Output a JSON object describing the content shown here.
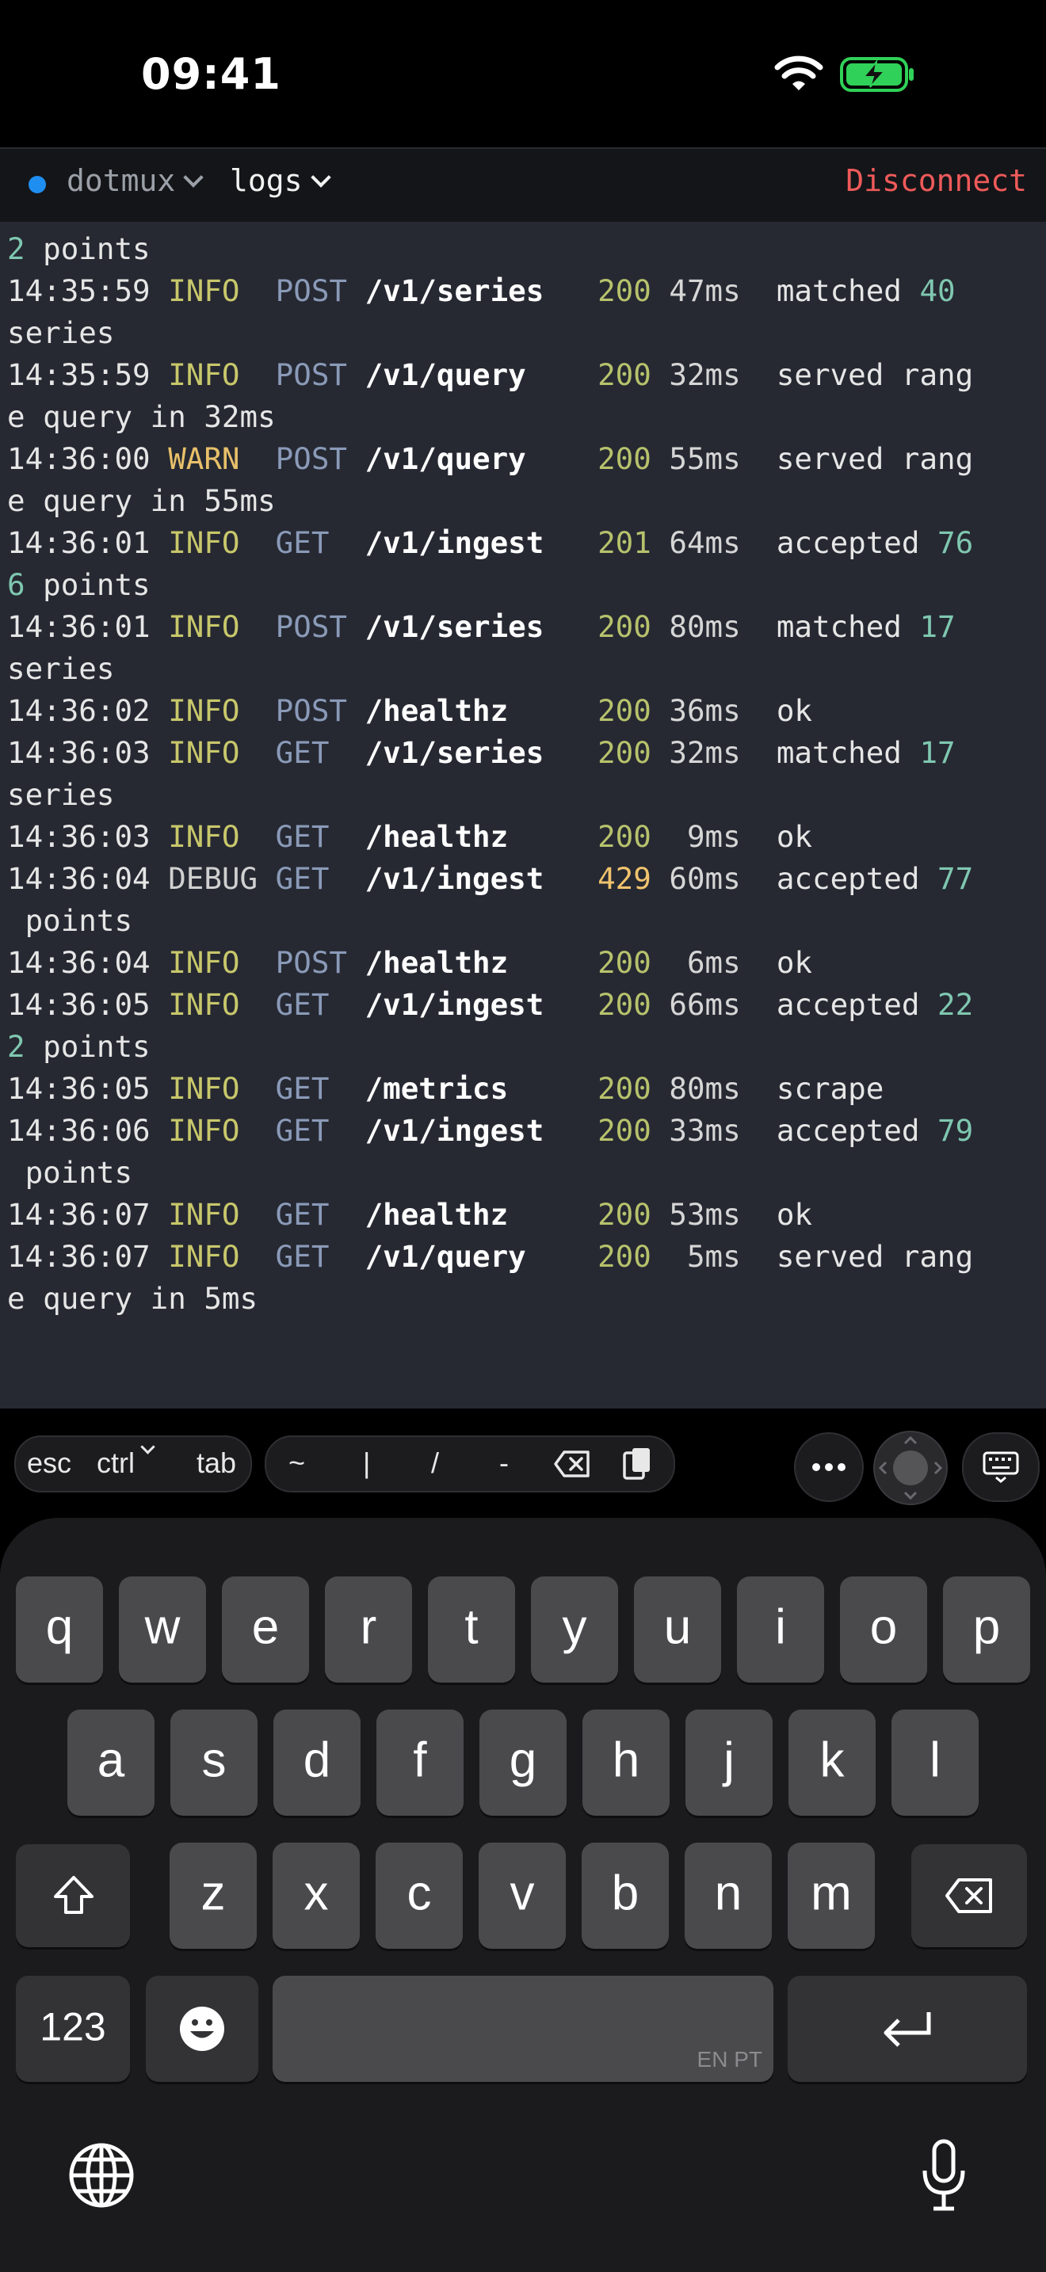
{
  "status_bar": {
    "time": "09:41",
    "wifi_icon": "wifi-icon",
    "battery_icon": "battery-charging-icon",
    "battery_color": "#30d158"
  },
  "tab_bar": {
    "connection_dot_color": "#1f8ef1",
    "session": "dotmux",
    "window": "logs",
    "disconnect": "Disconnect"
  },
  "terminal": {
    "top_fragment": {
      "num": "2",
      "text": " points"
    },
    "lines": [
      {
        "time": "14:35:59",
        "level": "INFO",
        "method": "POST",
        "path": "/v1/series",
        "status": "200",
        "duration": "47ms",
        "msg": "matched",
        "num": "40",
        "wrap": "series"
      },
      {
        "time": "14:35:59",
        "level": "INFO",
        "method": "POST",
        "path": "/v1/query",
        "status": "200",
        "duration": "32ms",
        "msg": "served rang",
        "wrap": "e query in 32ms"
      },
      {
        "time": "14:36:00",
        "level": "WARN",
        "method": "POST",
        "path": "/v1/query",
        "status": "200",
        "duration": "55ms",
        "msg": "served rang",
        "wrap": "e query in 55ms"
      },
      {
        "time": "14:36:01",
        "level": "INFO",
        "method": "GET",
        "path": "/v1/ingest",
        "status": "201",
        "duration": "64ms",
        "msg": "accepted",
        "num": "76",
        "wrap_num": "6",
        "wrap": " points"
      },
      {
        "time": "14:36:01",
        "level": "INFO",
        "method": "POST",
        "path": "/v1/series",
        "status": "200",
        "duration": "80ms",
        "msg": "matched",
        "num": "17",
        "wrap": "series"
      },
      {
        "time": "14:36:02",
        "level": "INFO",
        "method": "POST",
        "path": "/healthz",
        "status": "200",
        "duration": "36ms",
        "msg": "ok"
      },
      {
        "time": "14:36:03",
        "level": "INFO",
        "method": "GET",
        "path": "/v1/series",
        "status": "200",
        "duration": "32ms",
        "msg": "matched",
        "num": "17",
        "wrap": "series"
      },
      {
        "time": "14:36:03",
        "level": "INFO",
        "method": "GET",
        "path": "/healthz",
        "status": "200",
        "duration": "9ms",
        "msg": "ok"
      },
      {
        "time": "14:36:04",
        "level": "DEBUG",
        "method": "GET",
        "path": "/v1/ingest",
        "status": "429",
        "duration": "60ms",
        "msg": "accepted",
        "num": "77",
        "wrap": " points"
      },
      {
        "time": "14:36:04",
        "level": "INFO",
        "method": "POST",
        "path": "/healthz",
        "status": "200",
        "duration": "6ms",
        "msg": "ok"
      },
      {
        "time": "14:36:05",
        "level": "INFO",
        "method": "GET",
        "path": "/v1/ingest",
        "status": "200",
        "duration": "66ms",
        "msg": "accepted",
        "num": "22",
        "wrap_num": "2",
        "wrap": " points"
      },
      {
        "time": "14:36:05",
        "level": "INFO",
        "method": "GET",
        "path": "/metrics",
        "status": "200",
        "duration": "80ms",
        "msg": "scrape"
      },
      {
        "time": "14:36:06",
        "level": "INFO",
        "method": "GET",
        "path": "/v1/ingest",
        "status": "200",
        "duration": "33ms",
        "msg": "accepted",
        "num": "79",
        "wrap": " points"
      },
      {
        "time": "14:36:07",
        "level": "INFO",
        "method": "GET",
        "path": "/healthz",
        "status": "200",
        "duration": "53ms",
        "msg": "ok"
      },
      {
        "time": "14:36:07",
        "level": "INFO",
        "method": "GET",
        "path": "/v1/query",
        "status": "200",
        "duration": "5ms",
        "msg": "served rang",
        "wrap": "e query in 5ms"
      }
    ]
  },
  "accessory_bar": {
    "modifiers": {
      "esc": "esc",
      "ctrl": "ctrl",
      "tab": "tab"
    },
    "symbols": [
      "~",
      "|",
      "/",
      "-"
    ],
    "icons": [
      "backspace-icon",
      "paste-icon",
      "more-icon",
      "dpad-icon",
      "keyboard-icon"
    ]
  },
  "keyboard": {
    "row1": [
      "q",
      "w",
      "e",
      "r",
      "t",
      "y",
      "u",
      "i",
      "o",
      "p"
    ],
    "row2": [
      "a",
      "s",
      "d",
      "f",
      "g",
      "h",
      "j",
      "k",
      "l"
    ],
    "row3": [
      "z",
      "x",
      "c",
      "v",
      "b",
      "n",
      "m"
    ],
    "numbers_key": "123",
    "space_language": "EN PT",
    "icons": [
      "shift-icon",
      "delete-icon",
      "emoji-icon",
      "return-icon",
      "globe-icon",
      "microphone-icon"
    ]
  }
}
